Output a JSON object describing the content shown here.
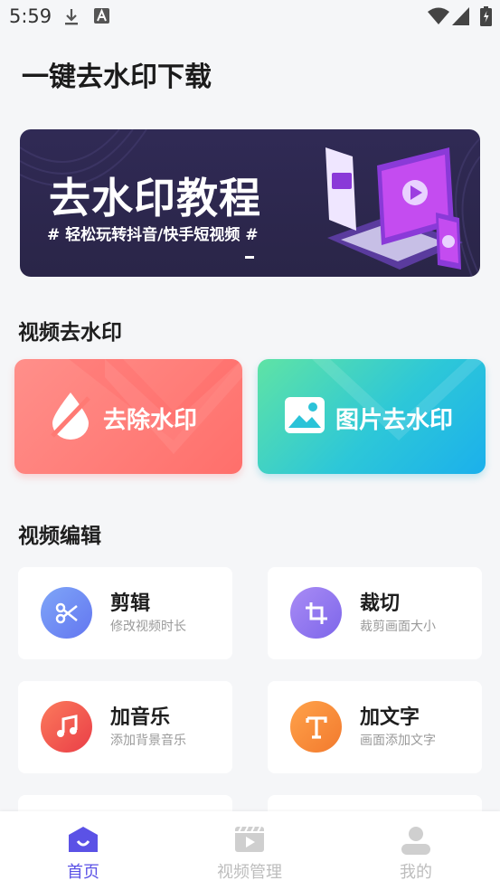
{
  "status_bar": {
    "time": "5:59",
    "icons": [
      "download-icon",
      "text-a-icon",
      "wifi-icon",
      "signal-icon",
      "battery-icon"
    ]
  },
  "header": {
    "title": "一键去水印下载"
  },
  "banner": {
    "title": "去水印教程",
    "subtitle": "# 轻松玩转抖音/快手短视频 #"
  },
  "sections": {
    "remove": {
      "title": "视频去水印"
    },
    "edit": {
      "title": "视频编辑"
    }
  },
  "remove_cards": [
    {
      "label": "去除水印",
      "icon": "drop-slash-icon",
      "color": "#ff7672"
    },
    {
      "label": "图片去水印",
      "icon": "image-icon",
      "color": "#2fc6d6"
    }
  ],
  "tools": [
    {
      "name": "剪辑",
      "desc": "修改视频时长",
      "icon": "scissors-icon",
      "color": "#6f8af6"
    },
    {
      "name": "裁切",
      "desc": "裁剪画面大小",
      "icon": "crop-icon",
      "color": "#8a72ee"
    },
    {
      "name": "加音乐",
      "desc": "添加背景音乐",
      "icon": "music-icon",
      "color": "#f0544c"
    },
    {
      "name": "加文字",
      "desc": "画面添加文字",
      "icon": "text-t-icon",
      "color": "#f6873a"
    }
  ],
  "bottom_nav": [
    {
      "label": "首页",
      "icon": "home-icon",
      "active": true
    },
    {
      "label": "视频管理",
      "icon": "video-icon",
      "active": false
    },
    {
      "label": "我的",
      "icon": "user-icon",
      "active": false
    }
  ],
  "colors": {
    "accent": "#5b52e6",
    "banner_bg": "#2c2650",
    "page_bg": "#f5f6f8"
  }
}
